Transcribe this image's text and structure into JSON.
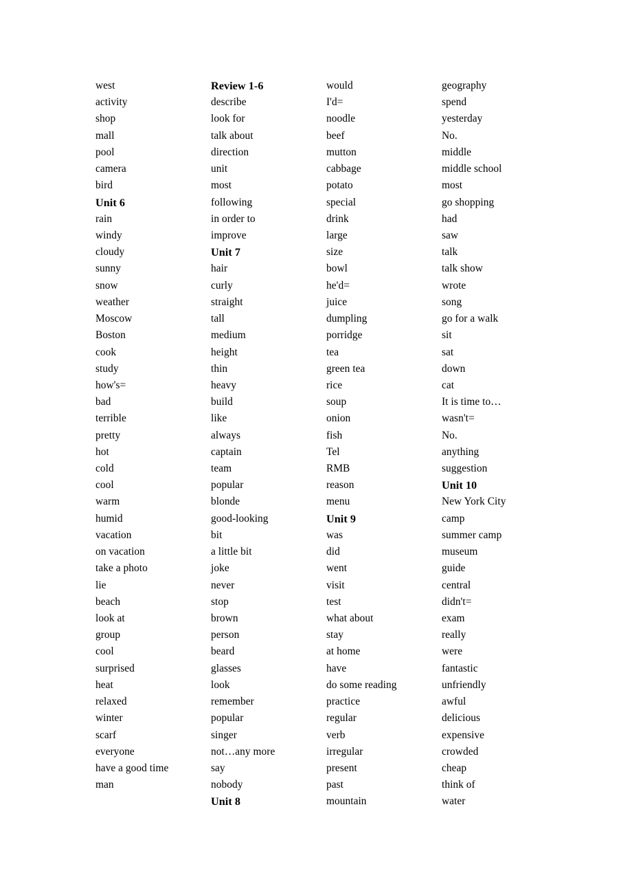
{
  "document": {
    "kind": "vocabulary-word-list",
    "page_background": "#ffffff",
    "text_color": "#000000",
    "column_count": 4
  },
  "columns": [
    {
      "index": 1,
      "entries": [
        {
          "text": "west",
          "header": false
        },
        {
          "text": "activity",
          "header": false
        },
        {
          "text": "shop",
          "header": false
        },
        {
          "text": "mall",
          "header": false
        },
        {
          "text": "pool",
          "header": false
        },
        {
          "text": "camera",
          "header": false
        },
        {
          "text": "bird",
          "header": false
        },
        {
          "text": "Unit 6",
          "header": true
        },
        {
          "text": "rain",
          "header": false
        },
        {
          "text": "windy",
          "header": false
        },
        {
          "text": "cloudy",
          "header": false
        },
        {
          "text": "sunny",
          "header": false
        },
        {
          "text": "snow",
          "header": false
        },
        {
          "text": "weather",
          "header": false
        },
        {
          "text": "Moscow",
          "header": false
        },
        {
          "text": "Boston",
          "header": false
        },
        {
          "text": "cook",
          "header": false
        },
        {
          "text": "study",
          "header": false
        },
        {
          "text": "how's=",
          "header": false
        },
        {
          "text": "bad",
          "header": false
        },
        {
          "text": "terrible",
          "header": false
        },
        {
          "text": "pretty",
          "header": false
        },
        {
          "text": "hot",
          "header": false
        },
        {
          "text": "cold",
          "header": false
        },
        {
          "text": "cool",
          "header": false
        },
        {
          "text": "warm",
          "header": false
        },
        {
          "text": "humid",
          "header": false
        },
        {
          "text": "vacation",
          "header": false
        },
        {
          "text": "on vacation",
          "header": false
        },
        {
          "text": "take a photo",
          "header": false
        },
        {
          "text": "lie",
          "header": false
        },
        {
          "text": "beach",
          "header": false
        },
        {
          "text": "look at",
          "header": false
        },
        {
          "text": "group",
          "header": false
        },
        {
          "text": "cool",
          "header": false
        },
        {
          "text": "surprised",
          "header": false
        },
        {
          "text": "heat",
          "header": false
        },
        {
          "text": "relaxed",
          "header": false
        },
        {
          "text": "winter",
          "header": false
        },
        {
          "text": "scarf",
          "header": false
        },
        {
          "text": "everyone",
          "header": false
        },
        {
          "text": "have a good time",
          "header": false
        },
        {
          "text": "man",
          "header": false
        }
      ]
    },
    {
      "index": 2,
      "entries": [
        {
          "text": "Review 1-6",
          "header": true
        },
        {
          "text": "describe",
          "header": false
        },
        {
          "text": "look for",
          "header": false
        },
        {
          "text": "talk about",
          "header": false
        },
        {
          "text": "direction",
          "header": false
        },
        {
          "text": "unit",
          "header": false
        },
        {
          "text": "most",
          "header": false
        },
        {
          "text": "following",
          "header": false
        },
        {
          "text": "in order to",
          "header": false
        },
        {
          "text": "improve",
          "header": false
        },
        {
          "text": "Unit 7",
          "header": true
        },
        {
          "text": "hair",
          "header": false
        },
        {
          "text": "curly",
          "header": false
        },
        {
          "text": "straight",
          "header": false
        },
        {
          "text": "tall",
          "header": false
        },
        {
          "text": "medium",
          "header": false
        },
        {
          "text": "height",
          "header": false
        },
        {
          "text": "thin",
          "header": false
        },
        {
          "text": "heavy",
          "header": false
        },
        {
          "text": "build",
          "header": false
        },
        {
          "text": "like",
          "header": false
        },
        {
          "text": "always",
          "header": false
        },
        {
          "text": "captain",
          "header": false
        },
        {
          "text": "team",
          "header": false
        },
        {
          "text": "popular",
          "header": false
        },
        {
          "text": "blonde",
          "header": false
        },
        {
          "text": "good-looking",
          "header": false
        },
        {
          "text": "bit",
          "header": false
        },
        {
          "text": "a little bit",
          "header": false
        },
        {
          "text": "joke",
          "header": false
        },
        {
          "text": "never",
          "header": false
        },
        {
          "text": "stop",
          "header": false
        },
        {
          "text": "brown",
          "header": false
        },
        {
          "text": "person",
          "header": false
        },
        {
          "text": "beard",
          "header": false
        },
        {
          "text": "glasses",
          "header": false
        },
        {
          "text": "look",
          "header": false
        },
        {
          "text": "remember",
          "header": false
        },
        {
          "text": "popular",
          "header": false
        },
        {
          "text": "singer",
          "header": false
        },
        {
          "text": "not…any more",
          "header": false
        },
        {
          "text": "say",
          "header": false
        },
        {
          "text": "nobody",
          "header": false
        },
        {
          "text": "Unit 8",
          "header": true
        }
      ]
    },
    {
      "index": 3,
      "entries": [
        {
          "text": "would",
          "header": false
        },
        {
          "text": "I'd=",
          "header": false
        },
        {
          "text": "noodle",
          "header": false
        },
        {
          "text": "beef",
          "header": false
        },
        {
          "text": "mutton",
          "header": false
        },
        {
          "text": "cabbage",
          "header": false
        },
        {
          "text": "potato",
          "header": false
        },
        {
          "text": "special",
          "header": false
        },
        {
          "text": "drink",
          "header": false
        },
        {
          "text": "large",
          "header": false
        },
        {
          "text": "size",
          "header": false
        },
        {
          "text": "bowl",
          "header": false
        },
        {
          "text": "he'd=",
          "header": false
        },
        {
          "text": "juice",
          "header": false
        },
        {
          "text": "dumpling",
          "header": false
        },
        {
          "text": "porridge",
          "header": false
        },
        {
          "text": "tea",
          "header": false
        },
        {
          "text": "green tea",
          "header": false
        },
        {
          "text": "rice",
          "header": false
        },
        {
          "text": "soup",
          "header": false
        },
        {
          "text": "onion",
          "header": false
        },
        {
          "text": "fish",
          "header": false
        },
        {
          "text": "Tel",
          "header": false
        },
        {
          "text": "RMB",
          "header": false
        },
        {
          "text": "reason",
          "header": false
        },
        {
          "text": "menu",
          "header": false
        },
        {
          "text": "Unit 9",
          "header": true
        },
        {
          "text": "was",
          "header": false
        },
        {
          "text": "did",
          "header": false
        },
        {
          "text": "went",
          "header": false
        },
        {
          "text": "visit",
          "header": false
        },
        {
          "text": "test",
          "header": false
        },
        {
          "text": "what about",
          "header": false
        },
        {
          "text": "stay",
          "header": false
        },
        {
          "text": "at home",
          "header": false
        },
        {
          "text": "have",
          "header": false
        },
        {
          "text": "do some reading",
          "header": false
        },
        {
          "text": "practice",
          "header": false
        },
        {
          "text": "regular",
          "header": false
        },
        {
          "text": "verb",
          "header": false
        },
        {
          "text": "irregular",
          "header": false
        },
        {
          "text": "present",
          "header": false
        },
        {
          "text": "past",
          "header": false
        },
        {
          "text": "mountain",
          "header": false
        }
      ]
    },
    {
      "index": 4,
      "entries": [
        {
          "text": "geography",
          "header": false
        },
        {
          "text": "spend",
          "header": false
        },
        {
          "text": "yesterday",
          "header": false
        },
        {
          "text": "No.",
          "header": false
        },
        {
          "text": "middle",
          "header": false
        },
        {
          "text": "middle school",
          "header": false
        },
        {
          "text": "most",
          "header": false
        },
        {
          "text": "go shopping",
          "header": false
        },
        {
          "text": "had",
          "header": false
        },
        {
          "text": "saw",
          "header": false
        },
        {
          "text": "talk",
          "header": false
        },
        {
          "text": "talk show",
          "header": false
        },
        {
          "text": "wrote",
          "header": false
        },
        {
          "text": "song",
          "header": false
        },
        {
          "text": "go for a walk",
          "header": false
        },
        {
          "text": "sit",
          "header": false
        },
        {
          "text": "sat",
          "header": false
        },
        {
          "text": "down",
          "header": false
        },
        {
          "text": "cat",
          "header": false
        },
        {
          "text": "It is time to…",
          "header": false
        },
        {
          "text": "wasn't=",
          "header": false
        },
        {
          "text": "No.",
          "header": false
        },
        {
          "text": "anything",
          "header": false
        },
        {
          "text": "suggestion",
          "header": false
        },
        {
          "text": "Unit 10",
          "header": true
        },
        {
          "text": "New York City",
          "header": false
        },
        {
          "text": "camp",
          "header": false
        },
        {
          "text": "summer camp",
          "header": false
        },
        {
          "text": "museum",
          "header": false
        },
        {
          "text": "guide",
          "header": false
        },
        {
          "text": "central",
          "header": false
        },
        {
          "text": "didn't=",
          "header": false
        },
        {
          "text": "exam",
          "header": false
        },
        {
          "text": "really",
          "header": false
        },
        {
          "text": "were",
          "header": false
        },
        {
          "text": "fantastic",
          "header": false
        },
        {
          "text": "unfriendly",
          "header": false
        },
        {
          "text": "awful",
          "header": false
        },
        {
          "text": "delicious",
          "header": false
        },
        {
          "text": "expensive",
          "header": false
        },
        {
          "text": "crowded",
          "header": false
        },
        {
          "text": "cheap",
          "header": false
        },
        {
          "text": "think of",
          "header": false
        },
        {
          "text": "water",
          "header": false
        }
      ]
    }
  ]
}
